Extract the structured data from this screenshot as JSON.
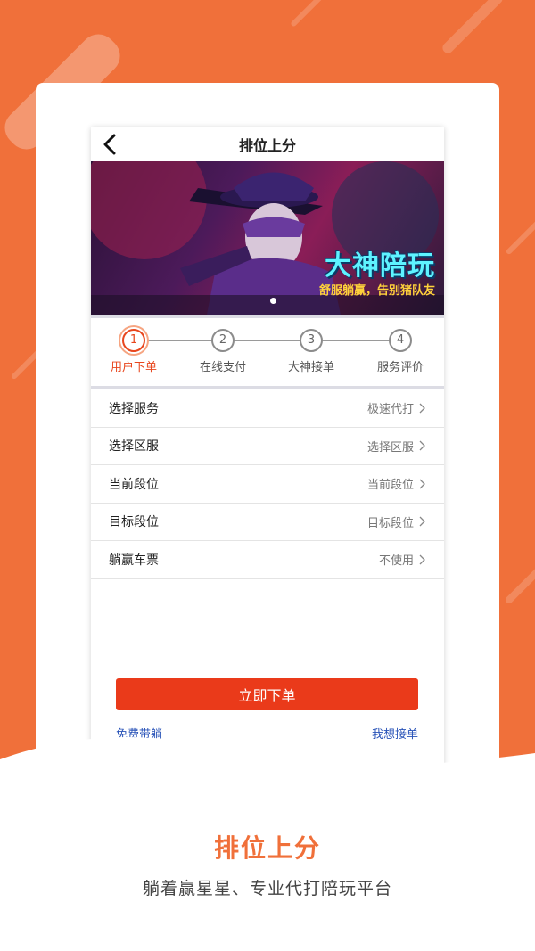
{
  "colors": {
    "brand": "#f0703a",
    "accent": "#ea3a1a",
    "link": "#2953b8"
  },
  "nav": {
    "title": "排位上分",
    "back_icon": "chevron-left-icon"
  },
  "banner": {
    "headline": "大神陪玩",
    "subtitle": "舒服躺赢，告别猪队友"
  },
  "steps": [
    {
      "num": "1",
      "label": "用户下单",
      "active": true
    },
    {
      "num": "2",
      "label": "在线支付",
      "active": false
    },
    {
      "num": "3",
      "label": "大神接单",
      "active": false
    },
    {
      "num": "4",
      "label": "服务评价",
      "active": false
    }
  ],
  "options": [
    {
      "label": "选择服务",
      "value": "极速代打"
    },
    {
      "label": "选择区服",
      "value": "选择区服"
    },
    {
      "label": "当前段位",
      "value": "当前段位"
    },
    {
      "label": "目标段位",
      "value": "目标段位"
    },
    {
      "label": "躺赢车票",
      "value": "不使用"
    }
  ],
  "actions": {
    "order_label": "立即下单",
    "free_link": "免费带躺",
    "take_order_link": "我想接单"
  },
  "footer": {
    "title": "排位上分",
    "slogan": "躺着赢星星、专业代打陪玩平台"
  }
}
